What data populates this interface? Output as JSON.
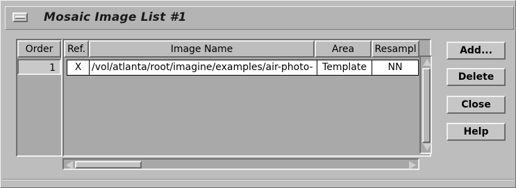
{
  "window": {
    "title": "Mosaic Image List #1"
  },
  "order": {
    "header": "Order",
    "values": [
      "1"
    ]
  },
  "table": {
    "columns": [
      "Ref.",
      "Image Name",
      "Area",
      "Resampl"
    ],
    "rows": [
      {
        "ref": "X",
        "image_name": "/vol/atlanta/root/imagine/examples/air-photo-",
        "area": "Template",
        "resample": "NN"
      }
    ]
  },
  "buttons": {
    "add": "Add...",
    "delete": "Delete",
    "close": "Close",
    "help": "Help"
  }
}
